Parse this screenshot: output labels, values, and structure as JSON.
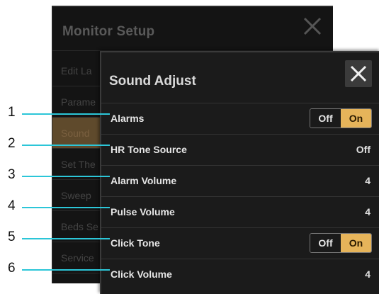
{
  "background_dialog": {
    "title": "Monitor Setup",
    "items": [
      "Edit La",
      "Parame",
      "Sound",
      "Set The",
      "Sweep",
      "Beds Se",
      "Service"
    ]
  },
  "dialog": {
    "title": "Sound Adjust",
    "rows": [
      {
        "label": "Alarms",
        "type": "toggle",
        "off": "Off",
        "on": "On",
        "selected": "On"
      },
      {
        "label": "HR Tone Source",
        "type": "value",
        "value": "Off"
      },
      {
        "label": "Alarm Volume",
        "type": "value",
        "value": "4"
      },
      {
        "label": "Pulse Volume",
        "type": "value",
        "value": "4"
      },
      {
        "label": "Click Tone",
        "type": "toggle",
        "off": "Off",
        "on": "On",
        "selected": "On"
      },
      {
        "label": "Click Volume",
        "type": "value",
        "value": "4"
      }
    ]
  },
  "callouts": [
    "1",
    "2",
    "3",
    "4",
    "5",
    "6"
  ],
  "colors": {
    "accent": "#e6b45a",
    "callout_line": "#2cc6d8",
    "dialog_bg": "#1b1b1b"
  },
  "icons": {
    "close": "close-icon"
  }
}
